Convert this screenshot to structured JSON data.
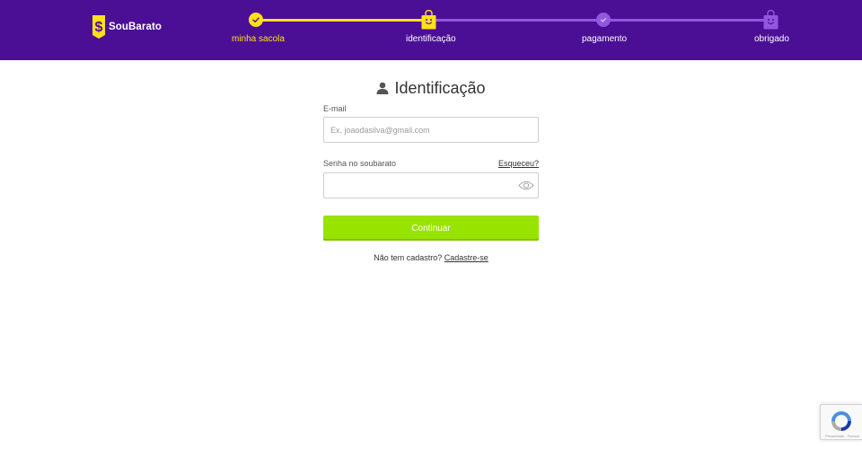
{
  "brand": {
    "name": "SouBarato"
  },
  "colors": {
    "header_bg": "#4b0f96",
    "step_done": "#ffe01b",
    "step_todo": "#9157e0",
    "button_bg": "#99e300"
  },
  "steps": [
    {
      "label": "minha sacola",
      "state": "done",
      "icon": "check-circle-icon"
    },
    {
      "label": "identificação",
      "state": "current",
      "icon": "shopping-bag-smile-icon"
    },
    {
      "label": "pagamento",
      "state": "upcoming",
      "icon": "check-circle-icon"
    },
    {
      "label": "obrigado",
      "state": "upcoming",
      "icon": "shopping-bag-smile-icon"
    }
  ],
  "form": {
    "title": "Identificação",
    "title_icon": "user-icon",
    "email_label": "E-mail",
    "email_placeholder": "Ex. joaodasilva@gmail.com",
    "email_value": "",
    "password_label": "Senha no soubarato",
    "password_value": "",
    "forgot_label": "Esqueceu?",
    "toggle_icon": "eye-icon",
    "submit_label": "Continuar",
    "signup_prompt": "Não tem cadastro?",
    "signup_link": "Cadastre-se"
  },
  "recaptcha": {
    "footer": "Privacidade - Termos"
  }
}
